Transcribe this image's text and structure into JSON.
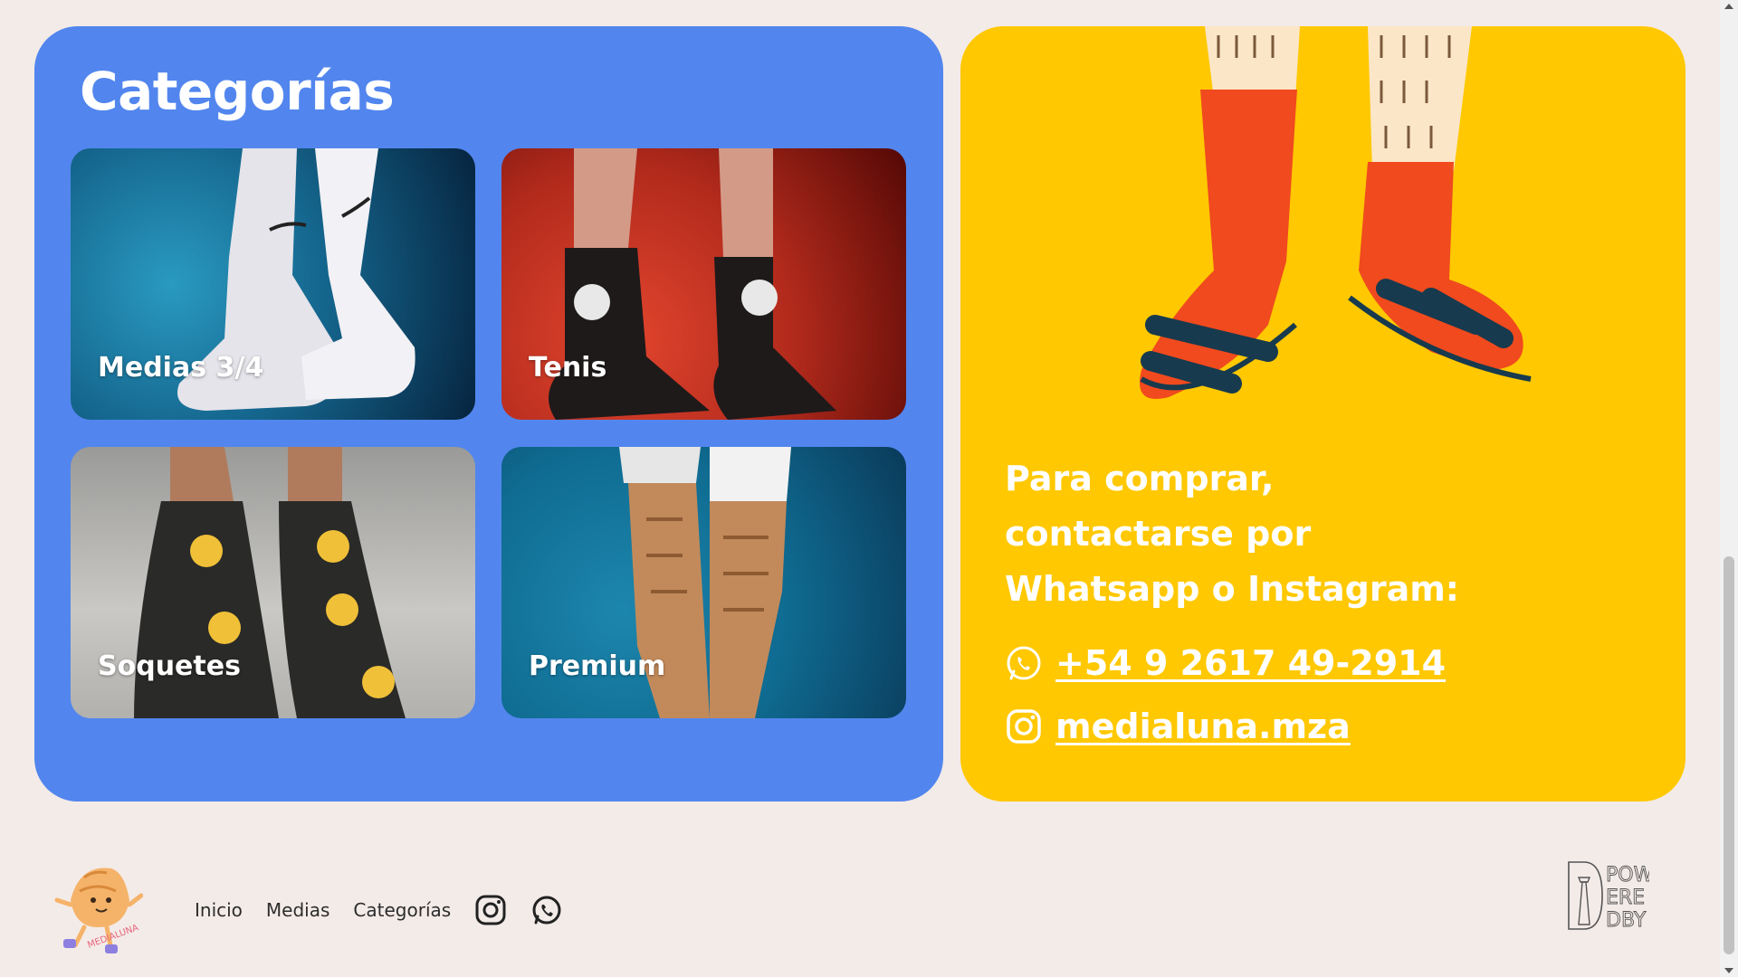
{
  "categories_section": {
    "title": "Categorías",
    "cards": [
      {
        "label": "Medias 3/4"
      },
      {
        "label": "Tenis"
      },
      {
        "label": "Soquetes"
      },
      {
        "label": "Premium"
      }
    ]
  },
  "contact_section": {
    "text": "Para comprar, contactarse por Whatsapp o Instagram:",
    "whatsapp": "+54 9 2617 49-2914",
    "instagram": "medialuna.mza"
  },
  "footer": {
    "logo_text": "MEDIALUNA",
    "nav": [
      "Inicio",
      "Medias",
      "Categorías"
    ],
    "powered_by": [
      "POW",
      "ERE",
      "DBY"
    ]
  },
  "colors": {
    "background": "#f3ebe8",
    "categories_panel": "#5286ee",
    "contact_panel": "#ffc800",
    "text_light": "#ffffff",
    "nav_text": "#2d2d2d"
  },
  "icons": [
    "whatsapp-icon",
    "instagram-icon",
    "medialuna-logo",
    "powered-by-logo"
  ]
}
